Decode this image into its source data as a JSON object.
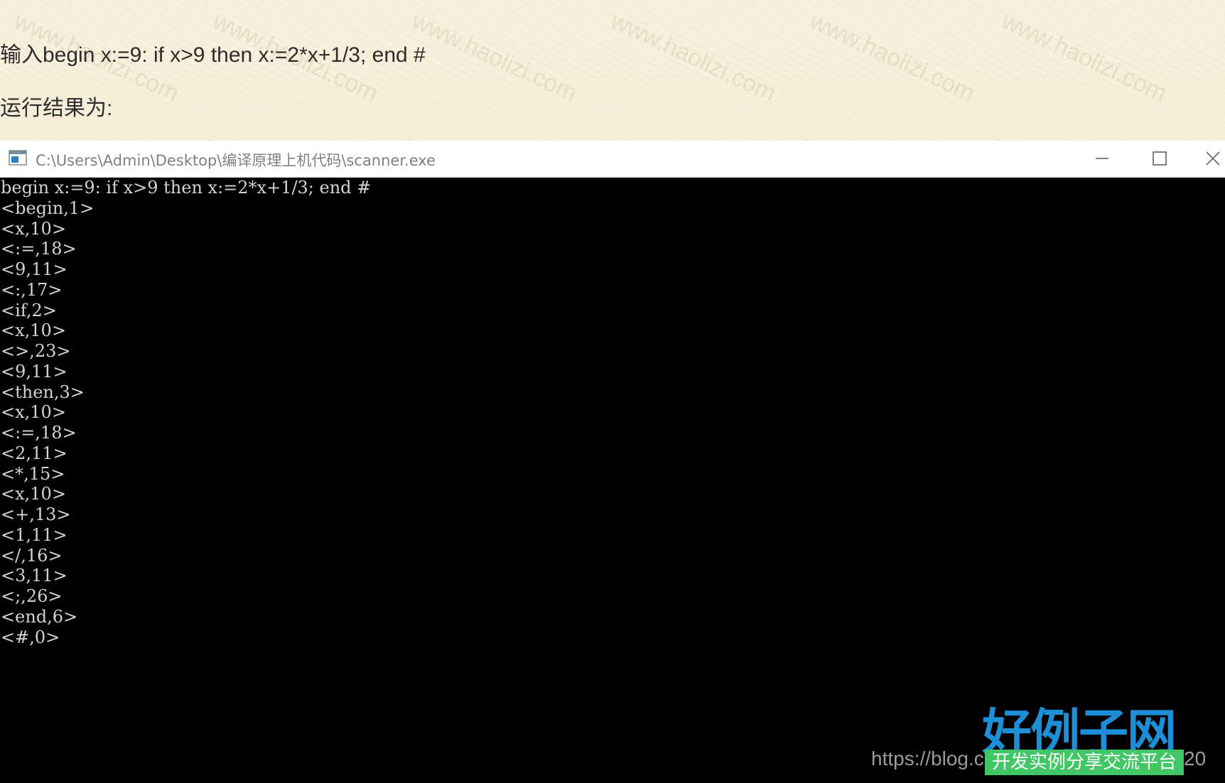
{
  "page": {
    "intro_text": "输入begin x:=9: if x>9 then x:=2*x+1/3; end #",
    "result_label": "运行结果为:"
  },
  "watermark": {
    "text": "www.haolizi.com"
  },
  "window": {
    "title": "C:\\Users\\Admin\\Desktop\\编译原理上机代码\\scanner.exe",
    "app_icon": "console-app-icon",
    "controls": {
      "minimize_icon": "minimize-icon",
      "maximize_icon": "maximize-icon",
      "close_icon": "close-icon"
    }
  },
  "console": {
    "lines": [
      "begin x:=9: if x>9 then x:=2*x+1/3; end #",
      "<begin,1>",
      "<x,10>",
      "<:=,18>",
      "<9,11>",
      "<:,17>",
      "<if,2>",
      "<x,10>",
      "<>,23>",
      "<9,11>",
      "<then,3>",
      "<x,10>",
      "<:=,18>",
      "<2,11>",
      "<*,15>",
      "<x,10>",
      "<+,13>",
      "<1,11>",
      "</,16>",
      "<3,11>",
      "<;,26>",
      "<end,6>",
      "<#,0>"
    ],
    "text_color": "#d2d2d2",
    "background_color": "#000000"
  },
  "branding": {
    "logo_text": "好例子网",
    "slogan": "开发实例分享交流平台",
    "blog_url_prefix": "https://blog.c",
    "blog_url_suffix": "20",
    "logo_color": "#1c8fd8",
    "slogan_bg": "#42c766"
  }
}
